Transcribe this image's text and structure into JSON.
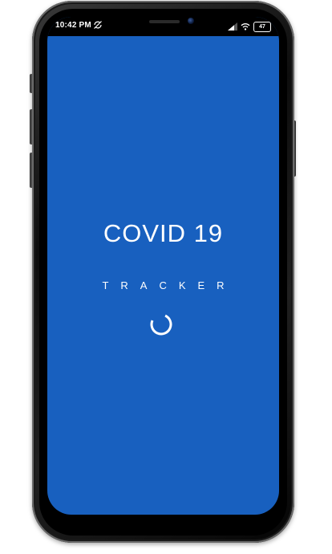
{
  "status_bar": {
    "time": "10:42 PM",
    "battery": "47",
    "icons": [
      "sync-off-icon",
      "signal-icon",
      "wifi-icon",
      "battery-icon"
    ]
  },
  "splash": {
    "title": "COVID 19",
    "subtitle": "TRACKER",
    "loading_indicator": "spinner-icon"
  },
  "colors": {
    "background": "#1860bf",
    "text": "#ffffff",
    "frame": "#111111"
  }
}
